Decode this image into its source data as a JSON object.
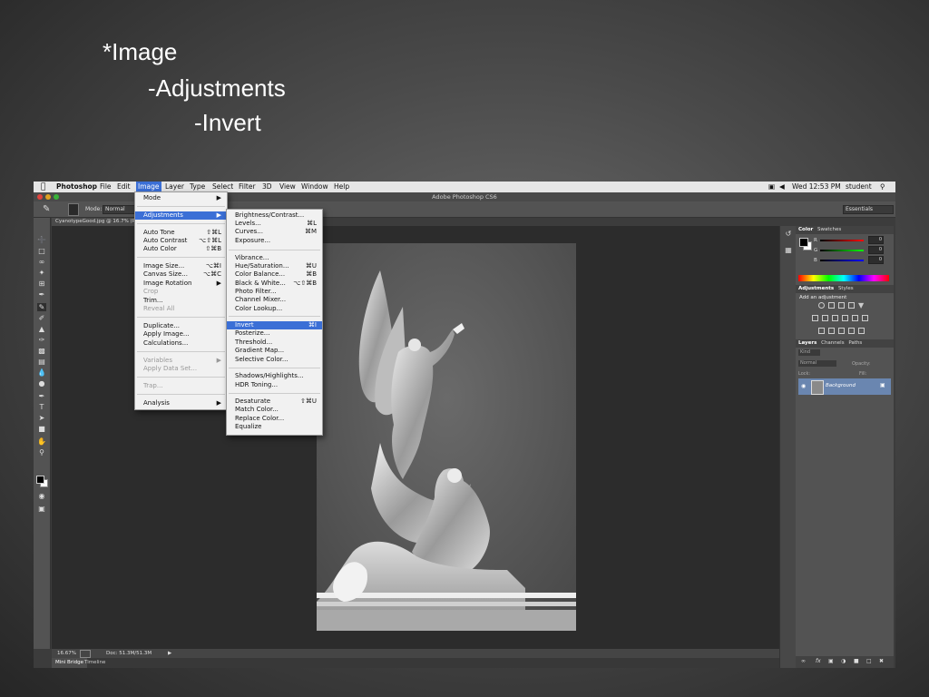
{
  "slide": {
    "line1": "*Image",
    "line2": "-Adjustments",
    "line3": "-Invert"
  },
  "menubar": {
    "app": "Photoshop",
    "items": [
      "File",
      "Edit",
      "Image",
      "Layer",
      "Type",
      "Select",
      "Filter",
      "3D",
      "View",
      "Window",
      "Help"
    ],
    "clock": "Wed 12:53 PM",
    "user": "student"
  },
  "window_title": "Adobe Photoshop CS6",
  "options": {
    "mode_label": "Mode:",
    "mode_value": "Normal",
    "workspace": "Essentials"
  },
  "document_tab": "CyanotypeGood.jpg @ 16.7% (R",
  "status": {
    "zoom": "16.67%",
    "doc": "Doc: 51.3M/51.3M"
  },
  "bottom_tabs": [
    "Mini Bridge",
    "Timeline"
  ],
  "image_menu": {
    "items": [
      {
        "label": "Mode",
        "shortcut": "▶",
        "disabled": false
      },
      {
        "label": "Adjustments",
        "shortcut": "▶",
        "disabled": false,
        "selected": true
      },
      {
        "label": "Auto Tone",
        "shortcut": "⇧⌘L",
        "disabled": false
      },
      {
        "label": "Auto Contrast",
        "shortcut": "⌥⇧⌘L",
        "disabled": false
      },
      {
        "label": "Auto Color",
        "shortcut": "⇧⌘B",
        "disabled": false
      },
      {
        "label": "Image Size...",
        "shortcut": "⌥⌘I",
        "disabled": false
      },
      {
        "label": "Canvas Size...",
        "shortcut": "⌥⌘C",
        "disabled": false
      },
      {
        "label": "Image Rotation",
        "shortcut": "▶",
        "disabled": false
      },
      {
        "label": "Crop",
        "shortcut": "",
        "disabled": true
      },
      {
        "label": "Trim...",
        "shortcut": "",
        "disabled": false
      },
      {
        "label": "Reveal All",
        "shortcut": "",
        "disabled": true
      },
      {
        "label": "Duplicate...",
        "shortcut": "",
        "disabled": false
      },
      {
        "label": "Apply Image...",
        "shortcut": "",
        "disabled": false
      },
      {
        "label": "Calculations...",
        "shortcut": "",
        "disabled": false
      },
      {
        "label": "Variables",
        "shortcut": "▶",
        "disabled": true
      },
      {
        "label": "Apply Data Set...",
        "shortcut": "",
        "disabled": true
      },
      {
        "label": "Trap...",
        "shortcut": "",
        "disabled": true
      },
      {
        "label": "Analysis",
        "shortcut": "▶",
        "disabled": false
      }
    ]
  },
  "adjustments_menu": {
    "items": [
      {
        "label": "Brightness/Contrast...",
        "shortcut": ""
      },
      {
        "label": "Levels...",
        "shortcut": "⌘L"
      },
      {
        "label": "Curves...",
        "shortcut": "⌘M"
      },
      {
        "label": "Exposure...",
        "shortcut": ""
      },
      {
        "label": "Vibrance...",
        "shortcut": ""
      },
      {
        "label": "Hue/Saturation...",
        "shortcut": "⌘U"
      },
      {
        "label": "Color Balance...",
        "shortcut": "⌘B"
      },
      {
        "label": "Black & White...",
        "shortcut": "⌥⇧⌘B"
      },
      {
        "label": "Photo Filter...",
        "shortcut": ""
      },
      {
        "label": "Channel Mixer...",
        "shortcut": ""
      },
      {
        "label": "Color Lookup...",
        "shortcut": ""
      },
      {
        "label": "Invert",
        "shortcut": "⌘I",
        "selected": true
      },
      {
        "label": "Posterize...",
        "shortcut": ""
      },
      {
        "label": "Threshold...",
        "shortcut": ""
      },
      {
        "label": "Gradient Map...",
        "shortcut": ""
      },
      {
        "label": "Selective Color...",
        "shortcut": ""
      },
      {
        "label": "Shadows/Highlights...",
        "shortcut": ""
      },
      {
        "label": "HDR Toning...",
        "shortcut": ""
      },
      {
        "label": "Desaturate",
        "shortcut": "⇧⌘U"
      },
      {
        "label": "Match Color...",
        "shortcut": ""
      },
      {
        "label": "Replace Color...",
        "shortcut": ""
      },
      {
        "label": "Equalize",
        "shortcut": ""
      }
    ]
  },
  "color_panel": {
    "tabs": [
      "Color",
      "Swatches"
    ],
    "channels": [
      {
        "label": "R",
        "value": "0"
      },
      {
        "label": "G",
        "value": "0"
      },
      {
        "label": "B",
        "value": "0"
      }
    ]
  },
  "adjustments_panel": {
    "tabs": [
      "Adjustments",
      "Styles"
    ],
    "heading": "Add an adjustment"
  },
  "layers_panel": {
    "tabs": [
      "Layers",
      "Channels",
      "Paths"
    ],
    "kind": "Kind",
    "blend": "Normal",
    "opacity_label": "Opacity:",
    "lock_label": "Lock:",
    "fill_label": "Fill:",
    "layer_name": "Background"
  }
}
